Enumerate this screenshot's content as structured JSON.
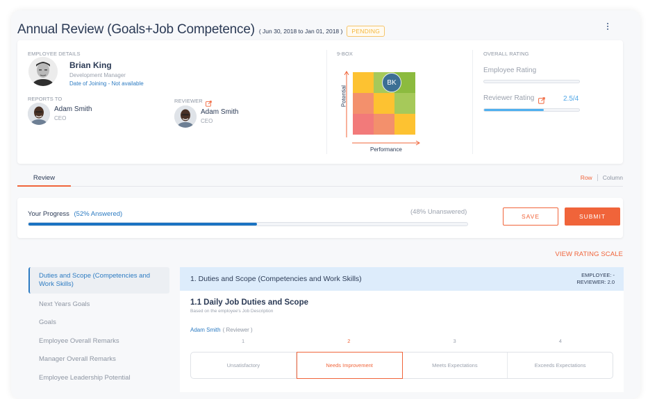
{
  "header": {
    "title": "Annual Review (Goals+Job Competence)",
    "date_range": "( Jun 30, 2018 to Jan 01, 2018 )",
    "status": "PENDING"
  },
  "employee": {
    "section_label": "EMPLOYEE DETAILS",
    "name": "Brian King",
    "title": "Development Manager",
    "joining": "Date of Joining - Not available"
  },
  "reports_to": {
    "label": "REPORTS TO",
    "name": "Adam Smith",
    "title": "CEO"
  },
  "reviewer": {
    "label": "REVIEWER",
    "name": "Adam Smith",
    "title": "CEO"
  },
  "ninebox": {
    "label": "9-BOX",
    "y_label": "Potential",
    "x_label": "Performance",
    "marker": "BK",
    "marker_cell": {
      "row": "top",
      "col": "middle"
    },
    "colors": [
      "#fdc231",
      "#a6c95a",
      "#8cbb3f",
      "#f3906c",
      "#fdc231",
      "#a6c95a",
      "#f27a7a",
      "#f3906c",
      "#fdc231"
    ]
  },
  "overall_rating": {
    "label": "OVERALL RATING",
    "employee_label": "Employee Rating",
    "employee_fraction": 0,
    "reviewer_label": "Reviewer Rating",
    "reviewer_value": "2.5/4",
    "reviewer_fraction": 0.625
  },
  "tabs": {
    "review": "Review",
    "row": "Row",
    "column": "Column"
  },
  "progress": {
    "label": "Your Progress",
    "answered": "(52% Answered)",
    "unanswered": "(48% Unanswered)",
    "percent": 52,
    "save": "SAVE",
    "submit": "SUBMIT"
  },
  "view_rating_scale": "VIEW RATING SCALE",
  "sidebar": {
    "items": [
      {
        "label": "Duties and Scope (Competencies and Work Skills)"
      },
      {
        "label": "Next Years Goals"
      },
      {
        "label": "Goals"
      },
      {
        "label": "Employee Overall Remarks"
      },
      {
        "label": "Manager Overall Remarks"
      },
      {
        "label": "Employee Leadership Potential"
      }
    ]
  },
  "section": {
    "title": "1. Duties and Scope (Competencies and Work Skills)",
    "employee_score": "EMPLOYEE: -",
    "reviewer_score": "REVIEWER: 2.0",
    "question_title": "1.1 Daily Job Duties and Scope",
    "question_sub": "Based on the employee's Job Description",
    "rater_name": "Adam Smith",
    "rater_role": "( Reviewer )",
    "scale_numbers": [
      "1",
      "2",
      "3",
      "4"
    ],
    "scale_options": [
      "Unsatisfactory",
      "Needs Improvement",
      "Meets Expectations",
      "Exceeds Expectations"
    ],
    "selected_index": 1
  },
  "colors": {
    "accent": "#f0643a",
    "primary_blue": "#2c7bc2",
    "progress_blue": "#1a73c2",
    "rating_blue": "#4fb0ef"
  }
}
